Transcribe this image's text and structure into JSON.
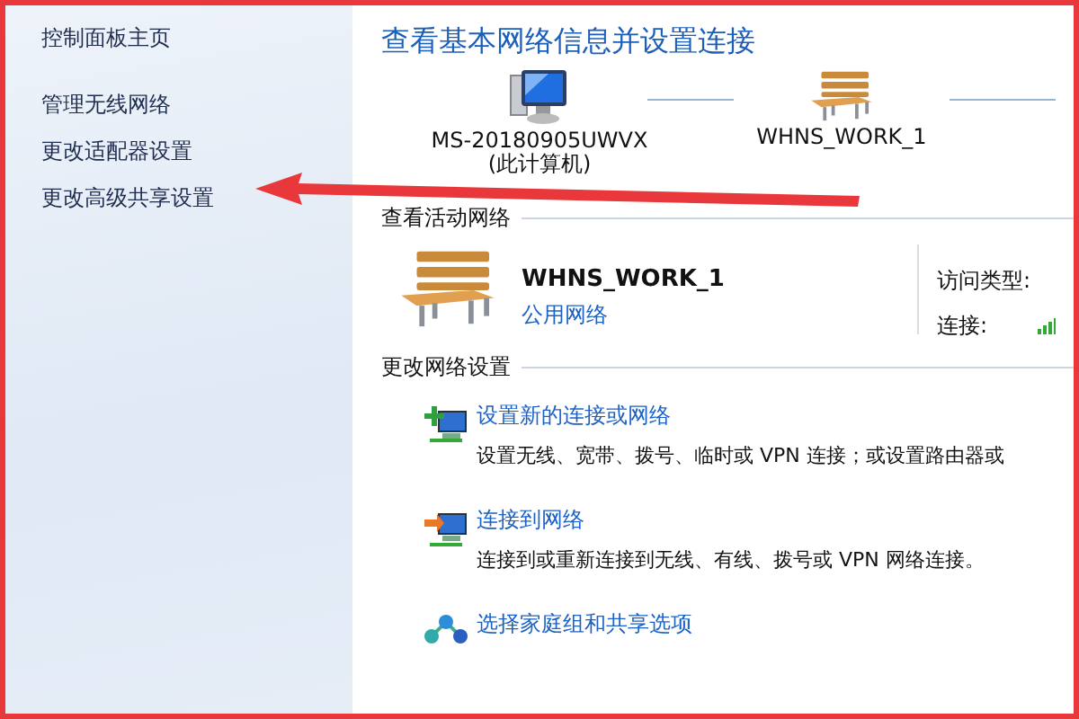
{
  "sidebar": {
    "home_link": "控制面板主页",
    "links": [
      "管理无线网络",
      "更改适配器设置",
      "更改高级共享设置"
    ]
  },
  "title": "查看基本网络信息并设置连接",
  "network_map": [
    {
      "kind": "computer",
      "name": "MS-20180905UWVX",
      "subtitle": "(此计算机)"
    },
    {
      "kind": "bench",
      "name": "WHNS_WORK_1"
    }
  ],
  "active_networks": {
    "heading": "查看活动网络",
    "network": {
      "name": "WHNS_WORK_1",
      "type_link": "公用网络"
    },
    "labels": [
      "访问类型:",
      "连接:"
    ]
  },
  "change_settings": {
    "heading": "更改网络设置",
    "tasks": [
      {
        "kind": "new-connection",
        "link": "设置新的连接或网络",
        "description": "设置无线、宽带、拨号、临时或 VPN 连接；或设置路由器或"
      },
      {
        "kind": "connect",
        "link": "连接到网络",
        "description": "连接到或重新连接到无线、有线、拨号或 VPN 网络连接。"
      },
      {
        "kind": "homegroup",
        "link": "选择家庭组和共享选项"
      }
    ]
  },
  "annotation_frame": true,
  "annotation_arrow": true
}
